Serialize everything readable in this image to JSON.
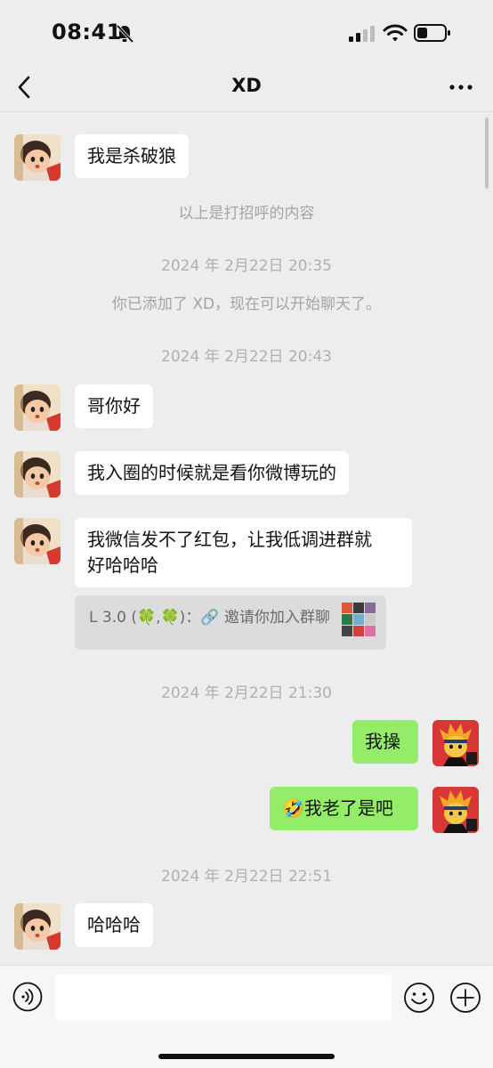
{
  "status_bar": {
    "time": "08:41"
  },
  "header": {
    "title": "XD"
  },
  "messages": {
    "greeting": "我是杀破狼",
    "greeting_note": "以上是打招呼的内容",
    "ts1": "2024 年 2月22日 20:35",
    "added_note": "你已添加了 XD，现在可以开始聊天了。",
    "ts2": "2024 年 2月22日 20:43",
    "m1": "哥你好",
    "m2": "我入圈的时候就是看你微博玩的",
    "m3_line1": "我微信发不了红包，让我低调进群就",
    "m3_line2": "好哈哈哈",
    "invite_text": "L 3.0 (🍀,🍀)：🔗 邀请你加入群聊",
    "ts3": "2024 年 2月22日 21:30",
    "out1": "我操",
    "out2_emoji": "🤣",
    "out2": "我老了是吧",
    "ts4": "2024 年 2月22日 22:51",
    "m4": "哈哈哈"
  },
  "input_bar": {
    "placeholder": ""
  },
  "colors": {
    "background": "#ededed",
    "incoming": "#ffffff",
    "outgoing": "#95ec69",
    "timestamp": "#a4a4a4"
  }
}
